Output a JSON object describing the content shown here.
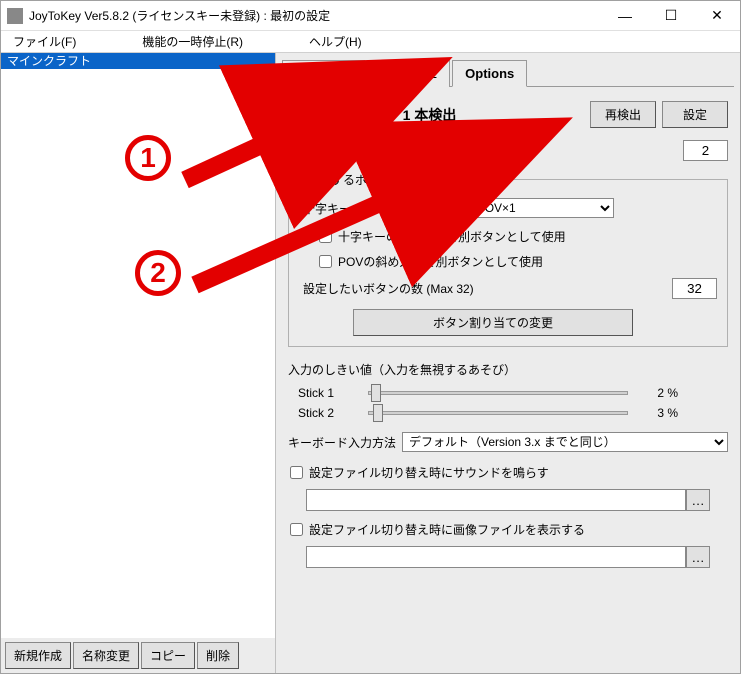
{
  "titlebar": {
    "title": "JoyToKey Ver5.8.2 (ライセンスキー未登録) : 最初の設定"
  },
  "menu": {
    "file": "ファイル(F)",
    "pause": "機能の一時停止(R)",
    "help": "ヘルプ(H)"
  },
  "sidebar": {
    "profile": "マインクラフト",
    "new": "新規作成",
    "rename": "名称変更",
    "copy": "コピー",
    "delete": "削除"
  },
  "tabs": {
    "joy1": "Joystick 1",
    "joy2": "Joystick 2",
    "options": "Options"
  },
  "options": {
    "heading_prefix": "ジョイスティック",
    "heading_suffix": "1 本検出",
    "redetect": "再検出",
    "settings": "設定",
    "joycount_label": "設定したいジョイスティックの数 (Max 32)",
    "joycount_value": "2",
    "button_group_legend": "表示するボタン設定",
    "pov_label": "十字キー・POV",
    "pov_select": "十字キー×2 + POV×1",
    "diag_cross": "十字キーの斜め入力を別ボタンとして使用",
    "diag_pov": "POVの斜め入力を別ボタンとして使用",
    "btncount_label": "設定したいボタンの数 (Max 32)",
    "btncount_value": "32",
    "change_assign": "ボタン割り当ての変更",
    "threshold_label": "入力のしきい値（入力を無視するあそび）",
    "stick1_label": "Stick 1",
    "stick1_pct": "2 %",
    "stick2_label": "Stick 2",
    "stick2_pct": "3 %",
    "kb_method_label": "キーボード入力方法",
    "kb_method_value": "デフォルト（Version 3.x までと同じ）",
    "sound_on_switch": "設定ファイル切り替え時にサウンドを鳴らす",
    "image_on_switch": "設定ファイル切り替え時に画像ファイルを表示する"
  },
  "annotations": {
    "one": "1",
    "two": "2"
  }
}
